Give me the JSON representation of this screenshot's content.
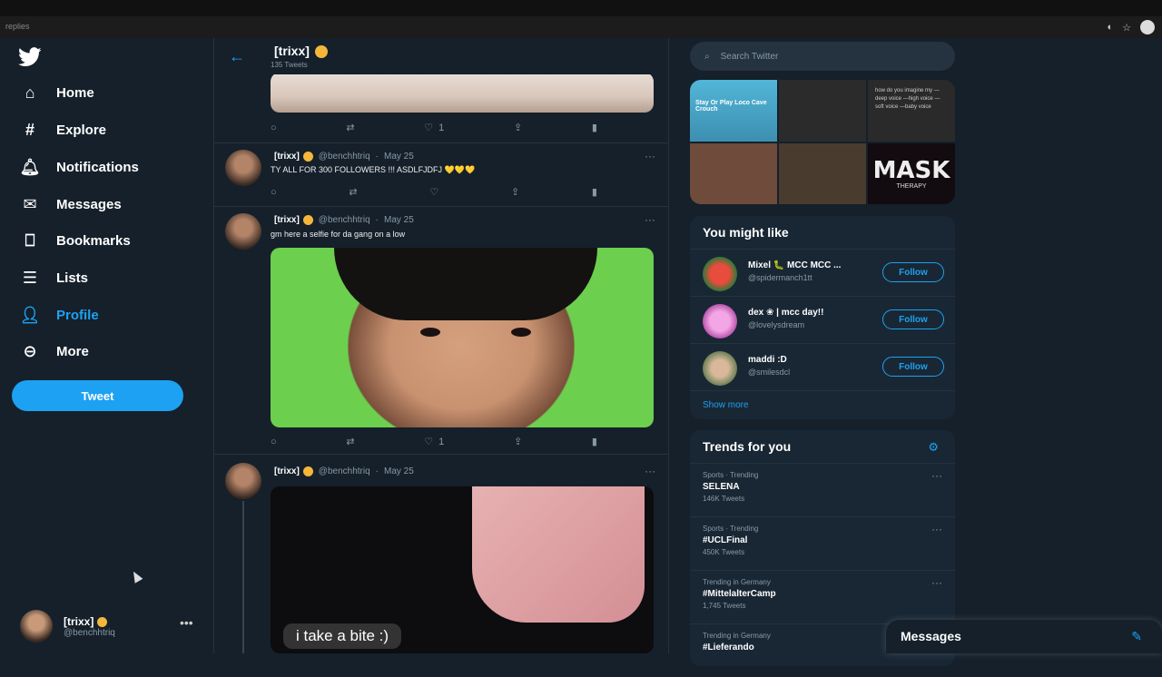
{
  "browser": {
    "url_fragment": "replies"
  },
  "nav": {
    "items": [
      {
        "label": "Home",
        "icon": "home-icon"
      },
      {
        "label": "Explore",
        "icon": "hashtag-icon"
      },
      {
        "label": "Notifications",
        "icon": "bell-icon"
      },
      {
        "label": "Messages",
        "icon": "mail-icon"
      },
      {
        "label": "Bookmarks",
        "icon": "bookmark-icon"
      },
      {
        "label": "Lists",
        "icon": "list-icon"
      },
      {
        "label": "Profile",
        "icon": "person-icon"
      },
      {
        "label": "More",
        "icon": "more-circle-icon"
      }
    ],
    "tweet_button": "Tweet",
    "account": {
      "name": "[trixx]",
      "handle": "@benchhtriq"
    }
  },
  "header": {
    "title": "[trixx]",
    "tweet_count": "135 Tweets"
  },
  "tweets": [
    {
      "actions": {
        "likes": "1"
      }
    },
    {
      "name": "[trixx]",
      "handle": "@benchhtriq",
      "date": "May 25",
      "text": "TY ALL FOR 300 FOLLOWERS !!! ASDLFJDFJ 💛💛💛"
    },
    {
      "name": "[trixx]",
      "handle": "@benchhtriq",
      "date": "May 25",
      "text": "gm here a selfie for da gang on a low",
      "likes": "1"
    },
    {
      "name": "[trixx]",
      "handle": "@benchhtriq",
      "date": "May 25",
      "caption": "i take a bite :)"
    }
  ],
  "right": {
    "search_placeholder": "Search Twitter",
    "media_grid": {
      "tile1_text": "Stay Or Play Loco Cave Crouch",
      "tile3_text": "how do you imagine my —deep voice —high voice —soft voice —baby voice",
      "tile6_text": "MASK",
      "tile6_sub": "THERAPY"
    },
    "you_might_like": {
      "title": "You might like",
      "users": [
        {
          "name": "Mixel 🐛 MCC MCC ...",
          "handle": "@spidermanch1tt",
          "button": "Follow",
          "color": "#c0392b"
        },
        {
          "name": "dex ❀ | mcc day!!",
          "handle": "@lovelysdream",
          "button": "Follow",
          "color": "#d873c9"
        },
        {
          "name": "maddi :D",
          "handle": "@smilesdcl",
          "button": "Follow",
          "color": "#7a9a6a"
        }
      ],
      "show_more": "Show more"
    },
    "trends": {
      "title": "Trends for you",
      "items": [
        {
          "category": "Sports · Trending",
          "title": "SELENA",
          "count": "146K Tweets"
        },
        {
          "category": "Sports · Trending",
          "title": "#UCLFinal",
          "count": "450K Tweets"
        },
        {
          "category": "Trending in Germany",
          "title": "#MittelalterCamp",
          "count": "1,745 Tweets"
        },
        {
          "category": "Trending in Germany",
          "title": "#Lieferando",
          "count": ""
        }
      ]
    }
  },
  "messages_drawer": {
    "title": "Messages"
  }
}
